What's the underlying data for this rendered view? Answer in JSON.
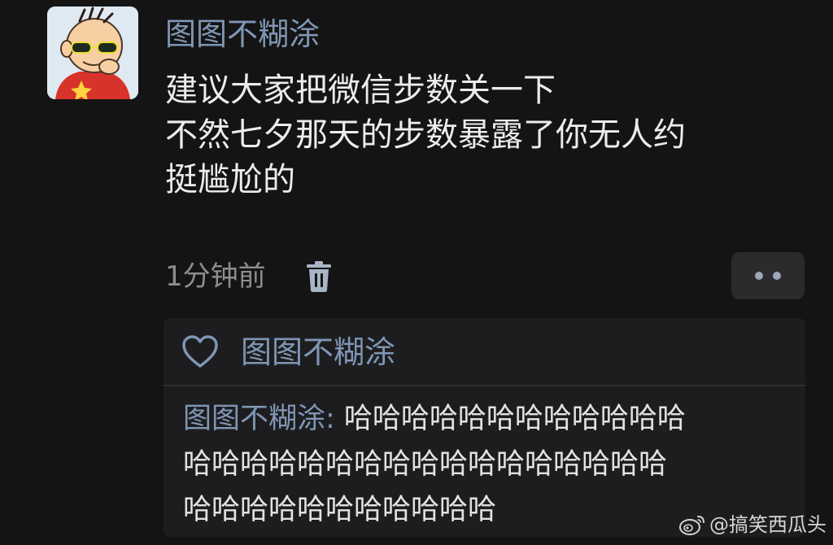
{
  "post": {
    "username": "图图不糊涂",
    "lines": [
      "建议大家把微信步数关一下",
      "不然七夕那天的步数暴露了你无人约",
      "挺尴尬的"
    ],
    "timestamp": "1分钟前"
  },
  "reply_panel": {
    "liker": "图图不糊涂",
    "comment": {
      "author": "图图不糊涂:",
      "line1": " 哈哈哈哈哈哈哈哈哈哈哈哈",
      "line2": "哈哈哈哈哈哈哈哈哈哈哈哈哈哈哈哈哈",
      "line3": "哈哈哈哈哈哈哈哈哈哈哈"
    }
  },
  "watermark": {
    "text": "@搞笑西瓜头"
  },
  "colors": {
    "background": "#141414",
    "username": "#7f96b4",
    "panel": "#1d1d1f"
  }
}
